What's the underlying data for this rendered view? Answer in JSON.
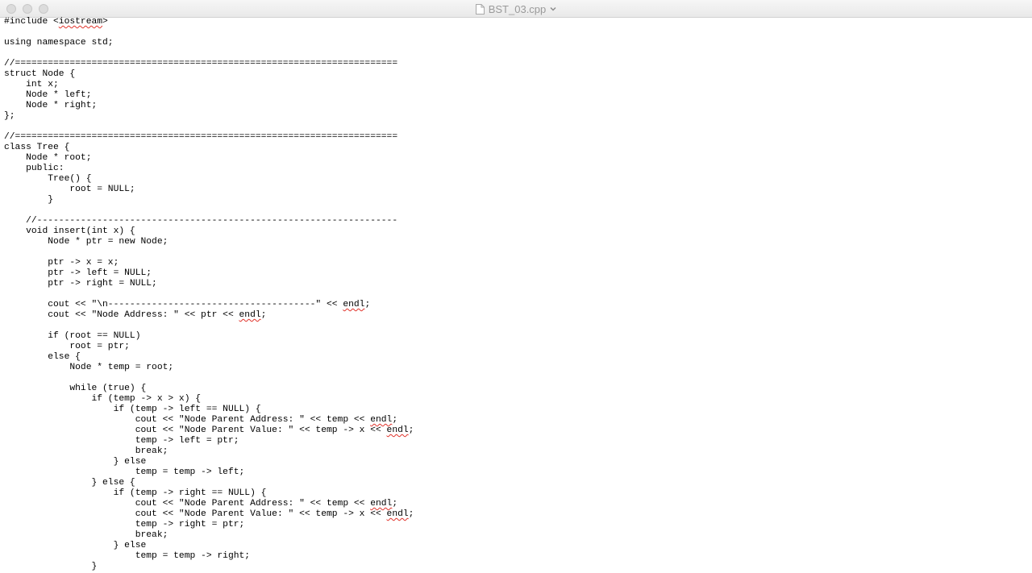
{
  "window": {
    "title": "BST_03.cpp",
    "icons": {
      "close": "close-button",
      "minimize": "minimize-button",
      "zoom": "zoom-button",
      "document": "document-icon",
      "title_menu": "chevron-down-icon"
    }
  },
  "colors": {
    "text": "#000000",
    "title_text": "#9a9a9a",
    "spelling_underline": "#e0322a"
  },
  "code": {
    "lines": [
      [
        {
          "t": "#include <"
        },
        {
          "t": "iostream",
          "spell": true
        },
        {
          "t": ">"
        }
      ],
      [],
      [
        {
          "t": "using namespace std;"
        }
      ],
      [],
      [
        {
          "t": "//======================================================================"
        }
      ],
      [
        {
          "t": "struct Node {"
        }
      ],
      [
        {
          "t": "    int x;"
        }
      ],
      [
        {
          "t": "    Node * left;"
        }
      ],
      [
        {
          "t": "    Node * right;"
        }
      ],
      [
        {
          "t": "};"
        }
      ],
      [],
      [
        {
          "t": "//======================================================================"
        }
      ],
      [
        {
          "t": "class Tree {"
        }
      ],
      [
        {
          "t": "    Node * root;"
        }
      ],
      [
        {
          "t": "    public:"
        }
      ],
      [
        {
          "t": "        Tree() {"
        }
      ],
      [
        {
          "t": "            root = NULL;"
        }
      ],
      [
        {
          "t": "        }"
        }
      ],
      [],
      [
        {
          "t": "    //------------------------------------------------------------------"
        }
      ],
      [
        {
          "t": "    void insert(int x) {"
        }
      ],
      [
        {
          "t": "        Node * ptr = new Node;"
        }
      ],
      [],
      [
        {
          "t": "        ptr -> x = x;"
        }
      ],
      [
        {
          "t": "        ptr -> left = NULL;"
        }
      ],
      [
        {
          "t": "        ptr -> right = NULL;"
        }
      ],
      [],
      [
        {
          "t": "        cout << \"\\n--------------------------------------\" << "
        },
        {
          "t": "endl",
          "spell": true
        },
        {
          "t": ";"
        }
      ],
      [
        {
          "t": "        cout << \"Node Address: \" << ptr << "
        },
        {
          "t": "endl",
          "spell": true
        },
        {
          "t": ";"
        }
      ],
      [],
      [
        {
          "t": "        if (root == NULL)"
        }
      ],
      [
        {
          "t": "            root = ptr;"
        }
      ],
      [
        {
          "t": "        else {"
        }
      ],
      [
        {
          "t": "            Node * temp = root;"
        }
      ],
      [],
      [
        {
          "t": "            while (true) {"
        }
      ],
      [
        {
          "t": "                if (temp -> x > x) {"
        }
      ],
      [
        {
          "t": "                    if (temp -> left == NULL) {"
        }
      ],
      [
        {
          "t": "                        cout << \"Node Parent Address: \" << temp << "
        },
        {
          "t": "endl",
          "spell": true
        },
        {
          "t": ";"
        }
      ],
      [
        {
          "t": "                        cout << \"Node Parent Value: \" << temp -> x << "
        },
        {
          "t": "endl",
          "spell": true
        },
        {
          "t": ";"
        }
      ],
      [
        {
          "t": "                        temp -> left = ptr;"
        }
      ],
      [
        {
          "t": "                        break;"
        }
      ],
      [
        {
          "t": "                    } else"
        }
      ],
      [
        {
          "t": "                        temp = temp -> left;"
        }
      ],
      [
        {
          "t": "                } else {"
        }
      ],
      [
        {
          "t": "                    if (temp -> right == NULL) {"
        }
      ],
      [
        {
          "t": "                        cout << \"Node Parent Address: \" << temp << "
        },
        {
          "t": "endl",
          "spell": true
        },
        {
          "t": ";"
        }
      ],
      [
        {
          "t": "                        cout << \"Node Parent Value: \" << temp -> x << "
        },
        {
          "t": "endl",
          "spell": true
        },
        {
          "t": ";"
        }
      ],
      [
        {
          "t": "                        temp -> right = ptr;"
        }
      ],
      [
        {
          "t": "                        break;"
        }
      ],
      [
        {
          "t": "                    } else"
        }
      ],
      [
        {
          "t": "                        temp = temp -> right;"
        }
      ],
      [
        {
          "t": "                }"
        }
      ]
    ]
  }
}
